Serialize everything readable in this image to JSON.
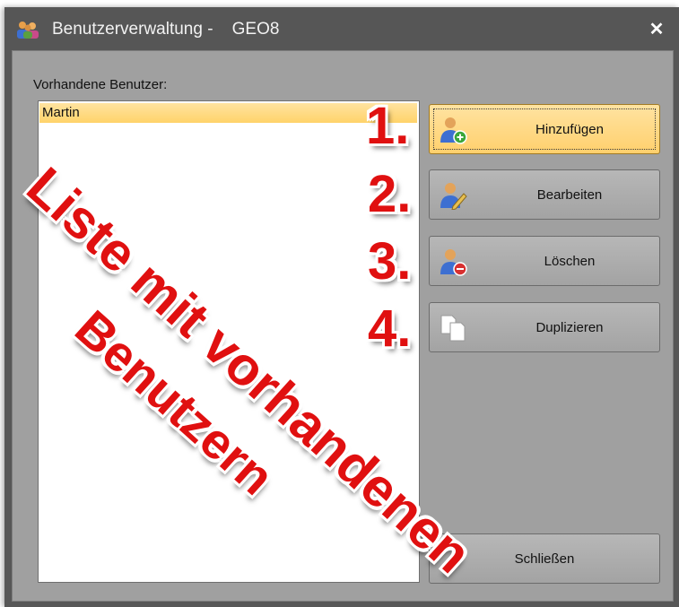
{
  "window": {
    "title": "Benutzerverwaltung -    GEO8",
    "close_glyph": "✕"
  },
  "users": {
    "label": "Vorhandene Benutzer:",
    "items": [
      "Martin"
    ]
  },
  "buttons": {
    "add": {
      "label": "Hinzufügen",
      "icon": "user-add-icon"
    },
    "edit": {
      "label": "Bearbeiten",
      "icon": "user-edit-icon"
    },
    "delete": {
      "label": "Löschen",
      "icon": "user-remove-icon"
    },
    "duplicate": {
      "label": "Duplizieren",
      "icon": "copy-icon"
    },
    "close": {
      "label": "Schließen"
    }
  },
  "annotations": {
    "numbers": [
      "1.",
      "2.",
      "3.",
      "4."
    ],
    "overlay_line1": "Liste mit vorhandenen",
    "overlay_line2": "Benutzern"
  },
  "colors": {
    "annotation_red": "#e01010",
    "selection_yellow": "#ffd36a"
  }
}
